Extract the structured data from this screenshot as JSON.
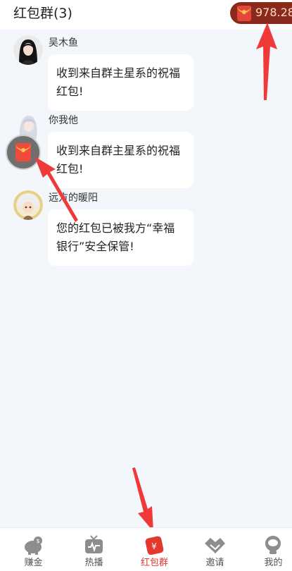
{
  "header": {
    "title": "红包群(3)",
    "balance": "978.28",
    "balance_icon": "red-envelope-icon"
  },
  "messages": [
    {
      "nickname": "吴木鱼",
      "text": "收到来自群主星系的祝福红包!",
      "avatar": "avatar-woman"
    },
    {
      "nickname": "你我他",
      "text": "收到来自群主星系的祝福红包!",
      "avatar": "avatar-anime-silver-hair"
    },
    {
      "nickname": "远方的暖阳",
      "text": "您的红包已被我方“幸福银行”安全保管!",
      "avatar": "avatar-cartoon-child"
    }
  ],
  "floating_button": {
    "icon": "red-envelope-icon"
  },
  "tabbar": {
    "active": "红包群",
    "items": [
      {
        "label": "赚金",
        "icon": "piggy-bank-icon"
      },
      {
        "label": "热播",
        "icon": "tv-icon"
      },
      {
        "label": "红包群",
        "icon": "red-envelope-icon"
      },
      {
        "label": "邀请",
        "icon": "handshake-icon"
      },
      {
        "label": "我的",
        "icon": "profile-icon"
      }
    ]
  },
  "colors": {
    "accent_red": "#e2382e",
    "balance_bg": "#8a2a1d",
    "page_bg": "#f3f6fb",
    "annotation_arrow": "#f03a3a"
  }
}
